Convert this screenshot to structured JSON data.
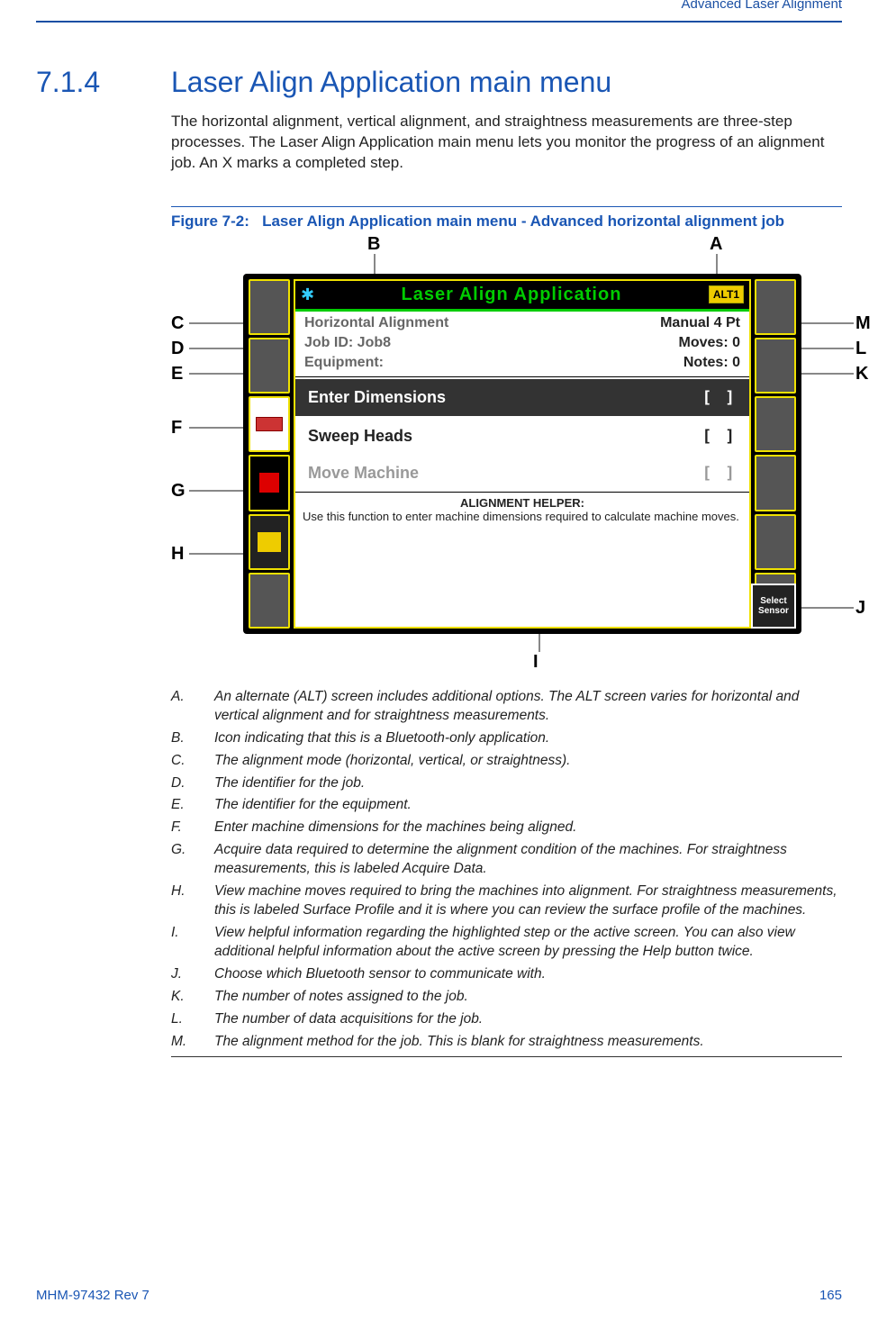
{
  "header": {
    "running_head": "Advanced Laser Alignment"
  },
  "section": {
    "number": "7.1.4",
    "title": "Laser Align Application main menu"
  },
  "intro": "The horizontal alignment, vertical alignment, and straightness measurements are three-step processes. The Laser Align Application main menu lets you monitor the progress of an alignment job. An X marks a completed step.",
  "figure": {
    "label": "Figure 7-2:",
    "caption": "Laser Align Application main menu - Advanced horizontal alignment job",
    "screen": {
      "title": "Laser Align Application",
      "alt_badge": "ALT1",
      "mode": "Horizontal Alignment",
      "method": "Manual 4 Pt",
      "job_id_label": "Job ID: Job8",
      "moves_label": "Moves: 0",
      "equipment_label": "Equipment:",
      "notes_label": "Notes: 0",
      "step1": "Enter Dimensions",
      "step1_state": "[   ]",
      "step2": "Sweep Heads",
      "step2_state": "[   ]",
      "step3": "Move Machine",
      "step3_state": "[   ]",
      "helper_title": "ALIGNMENT HELPER:",
      "helper_text": "Use this function to enter machine dimensions required to calculate machine moves.",
      "select_sensor": "Select Sensor"
    },
    "callouts": {
      "A": "A",
      "B": "B",
      "C": "C",
      "D": "D",
      "E": "E",
      "F": "F",
      "G": "G",
      "H": "H",
      "I": "I",
      "J": "J",
      "K": "K",
      "L": "L",
      "M": "M"
    }
  },
  "annotations": [
    {
      "k": "A.",
      "t": "An alternate (ALT) screen includes additional options. The ALT screen varies for horizontal and vertical alignment and for straightness measurements."
    },
    {
      "k": "B.",
      "t": "Icon indicating that this is a Bluetooth-only application."
    },
    {
      "k": "C.",
      "t": "The alignment mode (horizontal, vertical, or straightness)."
    },
    {
      "k": "D.",
      "t": "The identifier for the job."
    },
    {
      "k": "E.",
      "t": "The identifier for the equipment."
    },
    {
      "k": "F.",
      "t": "Enter machine dimensions for the machines being aligned."
    },
    {
      "k": "G.",
      "t": "Acquire data required to determine the alignment condition of the machines. For straightness measurements, this is labeled Acquire Data."
    },
    {
      "k": "H.",
      "t": "View machine moves required to bring the machines into alignment. For straightness measurements, this is labeled Surface Profile and it is where you can review the surface profile of the machines."
    },
    {
      "k": "I.",
      "t": "View helpful information regarding the highlighted step or the active screen. You can also view additional helpful information about the active screen by pressing the Help button twice."
    },
    {
      "k": "J.",
      "t": "Choose which Bluetooth sensor to communicate with."
    },
    {
      "k": "K.",
      "t": "The number of notes assigned to the job."
    },
    {
      "k": "L.",
      "t": "The number of data acquisitions for the job."
    },
    {
      "k": "M.",
      "t": "The alignment method for the job. This is blank for straightness measurements."
    }
  ],
  "footer": {
    "left": "MHM-97432 Rev 7",
    "right": "165"
  }
}
